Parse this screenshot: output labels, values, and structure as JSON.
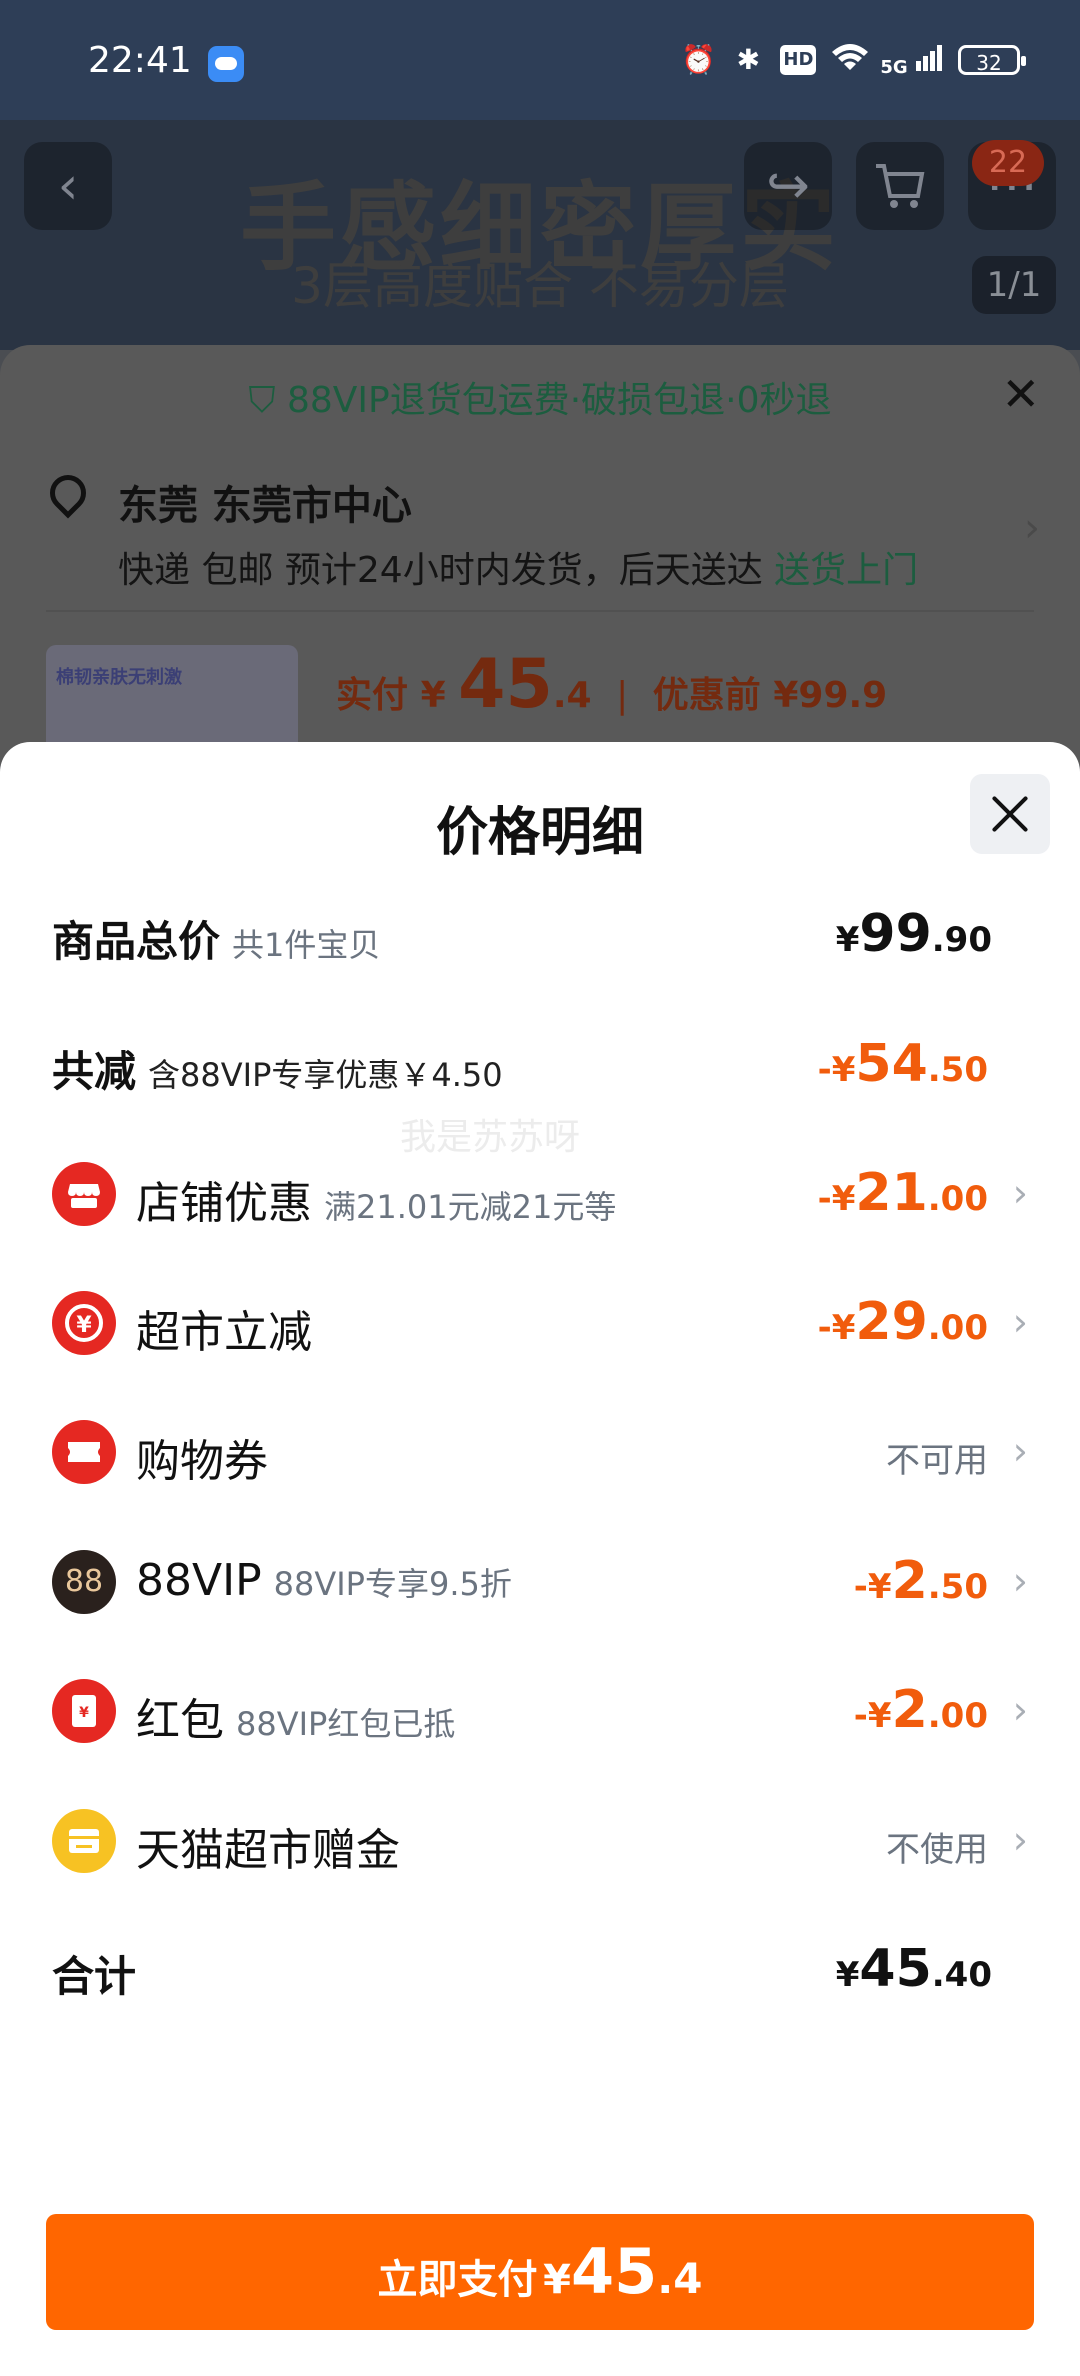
{
  "status_bar": {
    "time": "22:41",
    "battery": "32",
    "icons": [
      "weather-icon",
      "alarm-icon",
      "bluetooth-icon",
      "hd-icon",
      "wifi-icon",
      "5g-signal-icon",
      "battery-icon"
    ],
    "hd": "HD",
    "net": "5G"
  },
  "product_header": {
    "title": "手感细密厚实",
    "subtitle": "3层高度贴合  不易分层",
    "cart_badge": "22",
    "page_indicator": "1/1"
  },
  "shipping_sheet": {
    "banner": "88VIP退货包运费·破损包退·0秒退",
    "location": "东莞 东莞市中心",
    "shipping_text": "快递 包邮 预计24小时内发货，后天送达",
    "delivery_link": "送货上门",
    "thumb_text": "棉韧亲肤无刺激",
    "pay_label": "实付",
    "pay_currency": "¥",
    "pay_int": "45",
    "pay_dec": ".4",
    "before_label": "优惠前",
    "before_price": "¥99.9"
  },
  "price_detail": {
    "title": "价格明细",
    "rows": [
      {
        "label": "商品总价",
        "sub": "共1件宝贝",
        "cur": "¥",
        "int": "99",
        "dec": ".90"
      },
      {
        "label": "共减",
        "sub": "含88VIP专享优惠￥4.50",
        "cur": "-¥",
        "int": "54",
        "dec": ".50"
      },
      {
        "label": "店铺优惠",
        "sub": "满21.01元减21元等",
        "cur": "-¥",
        "int": "21",
        "dec": ".00",
        "icon": "shop-icon"
      },
      {
        "label": "超市立减",
        "sub": "",
        "cur": "-¥",
        "int": "29",
        "dec": ".00",
        "icon": "supermarket-icon"
      },
      {
        "label": "购物券",
        "sub": "",
        "text": "不可用",
        "icon": "coupon-icon"
      },
      {
        "label": "88VIP",
        "sub": "88VIP专享9.5折",
        "cur": "-¥",
        "int": "2",
        "dec": ".50",
        "icon": "88vip-icon"
      },
      {
        "label": "红包",
        "sub": "88VIP红包已抵",
        "cur": "-¥",
        "int": "2",
        "dec": ".00",
        "icon": "red-envelope-icon"
      },
      {
        "label": "天猫超市赠金",
        "sub": "",
        "text": "不使用",
        "icon": "gift-card-icon"
      },
      {
        "label": "合计",
        "sub": "",
        "cur": "¥",
        "int": "45",
        "dec": ".40"
      }
    ],
    "icon_glyphs": {
      "vip": "88",
      "yuan": "¥"
    }
  },
  "pay_button": {
    "label": "立即支付",
    "cur": "¥",
    "int": "45",
    "dec": ".4"
  },
  "watermark": "我是苏苏呀",
  "colors": {
    "accent_orange": "#ff6600",
    "discount_orange": "#f15c0c",
    "green": "#1c5d3f",
    "icon_red": "#e52822",
    "icon_dark": "#2a211d",
    "icon_yellow": "#f7c223"
  }
}
